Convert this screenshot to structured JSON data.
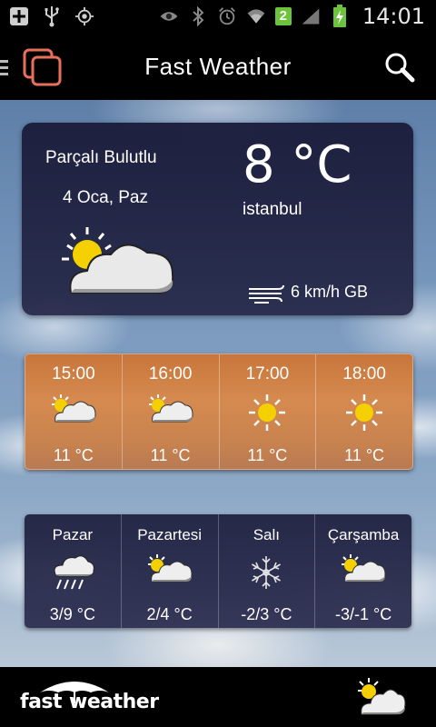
{
  "status_bar": {
    "time": "14:01",
    "badge": "2"
  },
  "action_bar": {
    "title": "Fast Weather"
  },
  "current": {
    "condition": "Parçalı Bulutlu",
    "date": "4 Oca, Paz",
    "temperature": "8 °C",
    "city": "istanbul",
    "wind": "6 km/h GB",
    "icon": "partly-cloudy-icon"
  },
  "hourly": [
    {
      "time": "15:00",
      "temp": "11 °C",
      "icon": "partly-cloudy-icon"
    },
    {
      "time": "16:00",
      "temp": "11 °C",
      "icon": "partly-cloudy-icon"
    },
    {
      "time": "17:00",
      "temp": "11 °C",
      "icon": "sun-icon"
    },
    {
      "time": "18:00",
      "temp": "11 °C",
      "icon": "sun-icon"
    }
  ],
  "daily": [
    {
      "day": "Pazar",
      "temp": "3/9 °C",
      "icon": "rain-icon"
    },
    {
      "day": "Pazartesi",
      "temp": "2/4 °C",
      "icon": "partly-cloudy-icon"
    },
    {
      "day": "Salı",
      "temp": "-2/3 °C",
      "icon": "snow-icon"
    },
    {
      "day": "Çarşamba",
      "temp": "-3/-1 °C",
      "icon": "partly-cloudy-icon"
    }
  ],
  "brand": {
    "part1": "fast",
    "part2": "weather"
  },
  "colors": {
    "logo_accent": "#e8705a",
    "hourly_bg": "#d58a4f",
    "card_bg": "#1f2140"
  }
}
